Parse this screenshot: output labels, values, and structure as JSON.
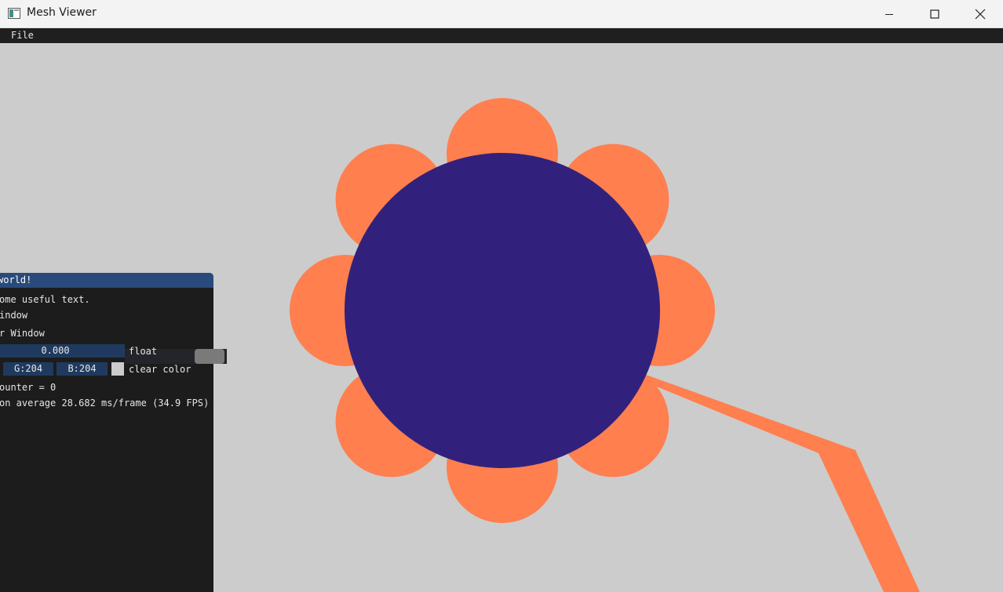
{
  "window": {
    "title": "Mesh Viewer",
    "controls": {
      "minimize": "minimize-icon",
      "maximize": "maximize-icon",
      "close": "close-icon"
    }
  },
  "menubar": {
    "items": [
      "File"
    ]
  },
  "scene": {
    "background_color": "#cccccc",
    "petal_color": "#ff7f4f",
    "center_color": "#32217c",
    "petal_count": 8
  },
  "panel": {
    "title": "world!",
    "text": "ome useful text.",
    "checkbox_demo": "indow",
    "checkbox_another": "r Window",
    "float_value": "0.000",
    "float_label": "float",
    "color_g": "G:204",
    "color_b": "B:204",
    "color_label": "clear color",
    "counter": "ounter = 0",
    "perf": "on average 28.682 ms/frame (34.9 FPS)",
    "accent_color": "#294a7a"
  }
}
